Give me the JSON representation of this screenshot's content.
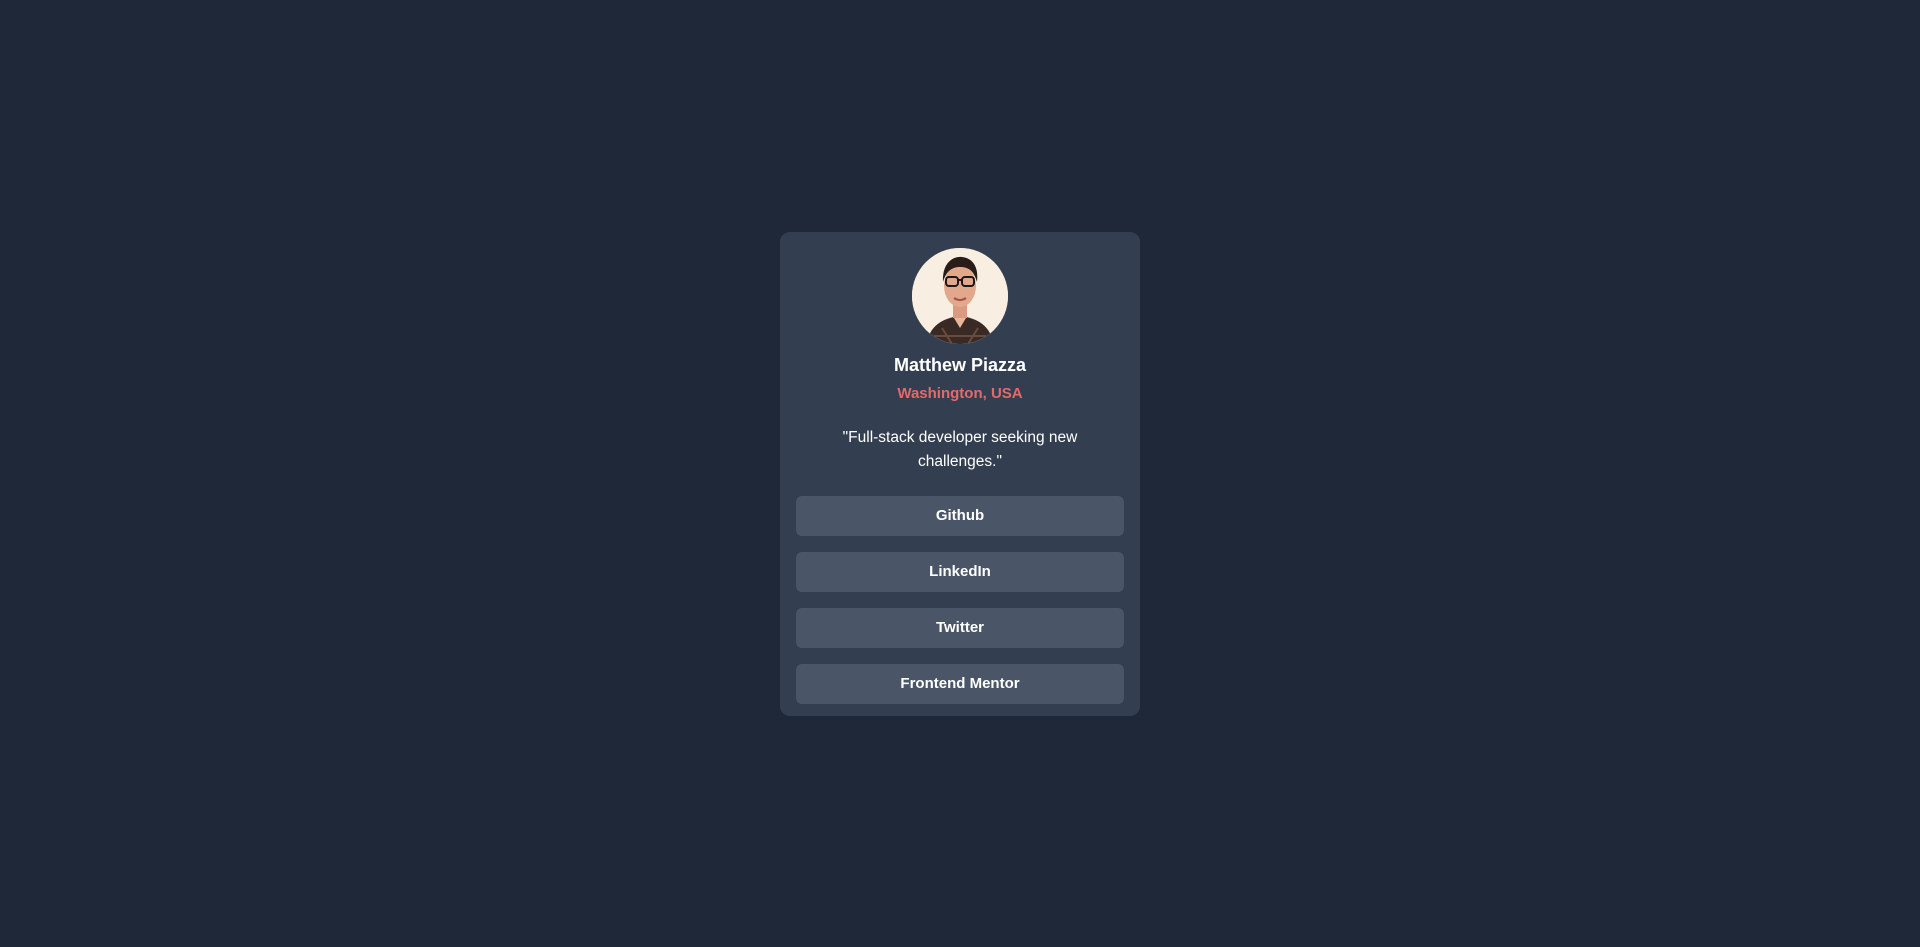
{
  "profile": {
    "name": "Matthew Piazza",
    "location": "Washington, USA",
    "bio": "\"Full-stack developer seeking new challenges.\"",
    "avatar_icon": "profile-photo"
  },
  "links": [
    {
      "label": "Github"
    },
    {
      "label": "LinkedIn"
    },
    {
      "label": "Twitter"
    },
    {
      "label": "Frontend Mentor"
    }
  ],
  "colors": {
    "background": "#1f2839",
    "card": "#333f51",
    "button": "#4a5568",
    "accent": "#e26a6a",
    "text": "#ffffff"
  }
}
